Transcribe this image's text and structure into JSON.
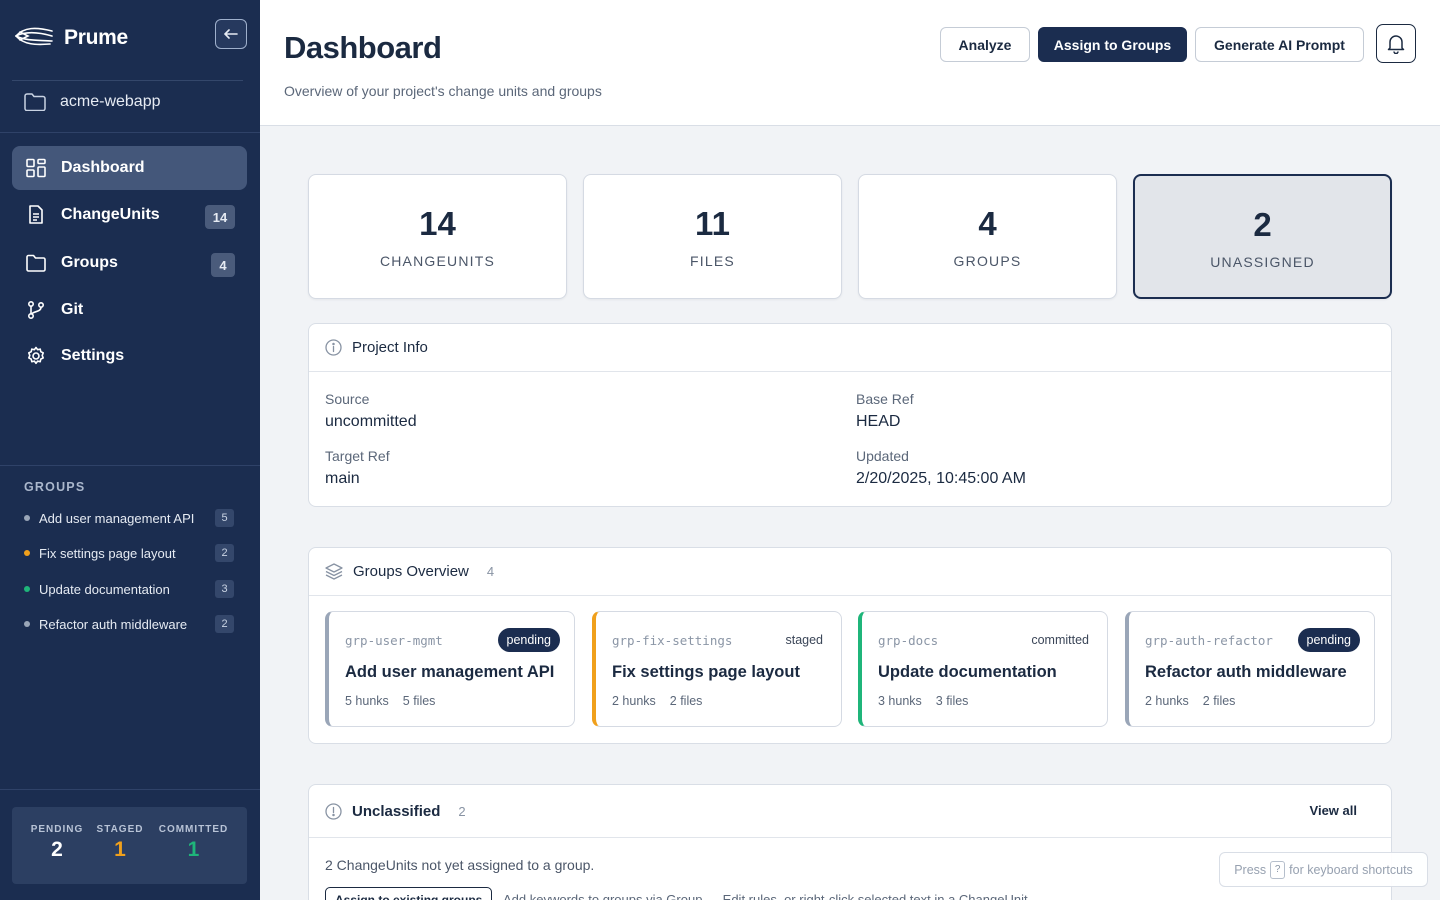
{
  "app": {
    "name": "Prume"
  },
  "sidebar": {
    "project": "acme-webapp",
    "nav": [
      {
        "label": "Dashboard",
        "icon": "dashboard-icon",
        "badge": "",
        "active": true
      },
      {
        "label": "ChangeUnits",
        "icon": "document-icon",
        "badge": "14"
      },
      {
        "label": "Groups",
        "icon": "folder-icon",
        "badge": "4"
      },
      {
        "label": "Git",
        "icon": "git-branch-icon",
        "badge": ""
      },
      {
        "label": "Settings",
        "icon": "gear-icon",
        "badge": ""
      }
    ],
    "groups_title": "GROUPS",
    "groups": [
      {
        "label": "Add user management API",
        "count": "5",
        "color": "#9aa6b8"
      },
      {
        "label": "Fix settings page layout",
        "count": "2",
        "color": "#f0a01c"
      },
      {
        "label": "Update documentation",
        "count": "3",
        "color": "#1fb57a"
      },
      {
        "label": "Refactor auth middleware",
        "count": "2",
        "color": "#9aa6b8"
      }
    ],
    "status": [
      {
        "label": "PENDING",
        "value": "2",
        "color": "#ffffff"
      },
      {
        "label": "STAGED",
        "value": "1",
        "color": "#f0a01c"
      },
      {
        "label": "COMMITTED",
        "value": "1",
        "color": "#1fb57a"
      }
    ]
  },
  "header": {
    "title": "Dashboard",
    "subtitle": "Overview of your project's change units and groups",
    "buttons": {
      "analyze": "Analyze",
      "assign": "Assign to Groups",
      "prompt": "Generate AI Prompt"
    }
  },
  "stats": [
    {
      "value": "14",
      "label": "CHANGEUNITS"
    },
    {
      "value": "11",
      "label": "FILES"
    },
    {
      "value": "4",
      "label": "GROUPS"
    },
    {
      "value": "2",
      "label": "UNASSIGNED"
    }
  ],
  "project_info": {
    "title": "Project Info",
    "source_label": "Source",
    "source": "uncommitted",
    "base_label": "Base Ref",
    "base": "HEAD",
    "target_label": "Target Ref",
    "target": "main",
    "updated_label": "Updated",
    "updated": "2/20/2025, 10:45:00 AM"
  },
  "groups_overview": {
    "title": "Groups Overview",
    "count": "4",
    "cards": [
      {
        "id": "grp-user-mgmt",
        "status": "pending",
        "name": "Add user management API",
        "hunks": "5 hunks",
        "files": "5 files",
        "color": "#9aa6b8"
      },
      {
        "id": "grp-fix-settings",
        "status": "staged",
        "name": "Fix settings page layout",
        "hunks": "2 hunks",
        "files": "2 files",
        "color": "#f0a01c"
      },
      {
        "id": "grp-docs",
        "status": "committed",
        "name": "Update documentation",
        "hunks": "3 hunks",
        "files": "3 files",
        "color": "#1fb57a"
      },
      {
        "id": "grp-auth-refactor",
        "status": "pending",
        "name": "Refactor auth middleware",
        "hunks": "2 hunks",
        "files": "2 files",
        "color": "#9aa6b8"
      }
    ]
  },
  "unclassified": {
    "title": "Unclassified",
    "count": "2",
    "view_all": "View all",
    "text": "2 ChangeUnits not yet assigned to a group.",
    "button": "Assign to existing groups",
    "hint": "Add keywords to groups via Group → Edit rules, or right-click selected text in a ChangeUnit"
  },
  "shortcut": {
    "prefix": "Press",
    "key": "?",
    "suffix": "for keyboard shortcuts"
  }
}
